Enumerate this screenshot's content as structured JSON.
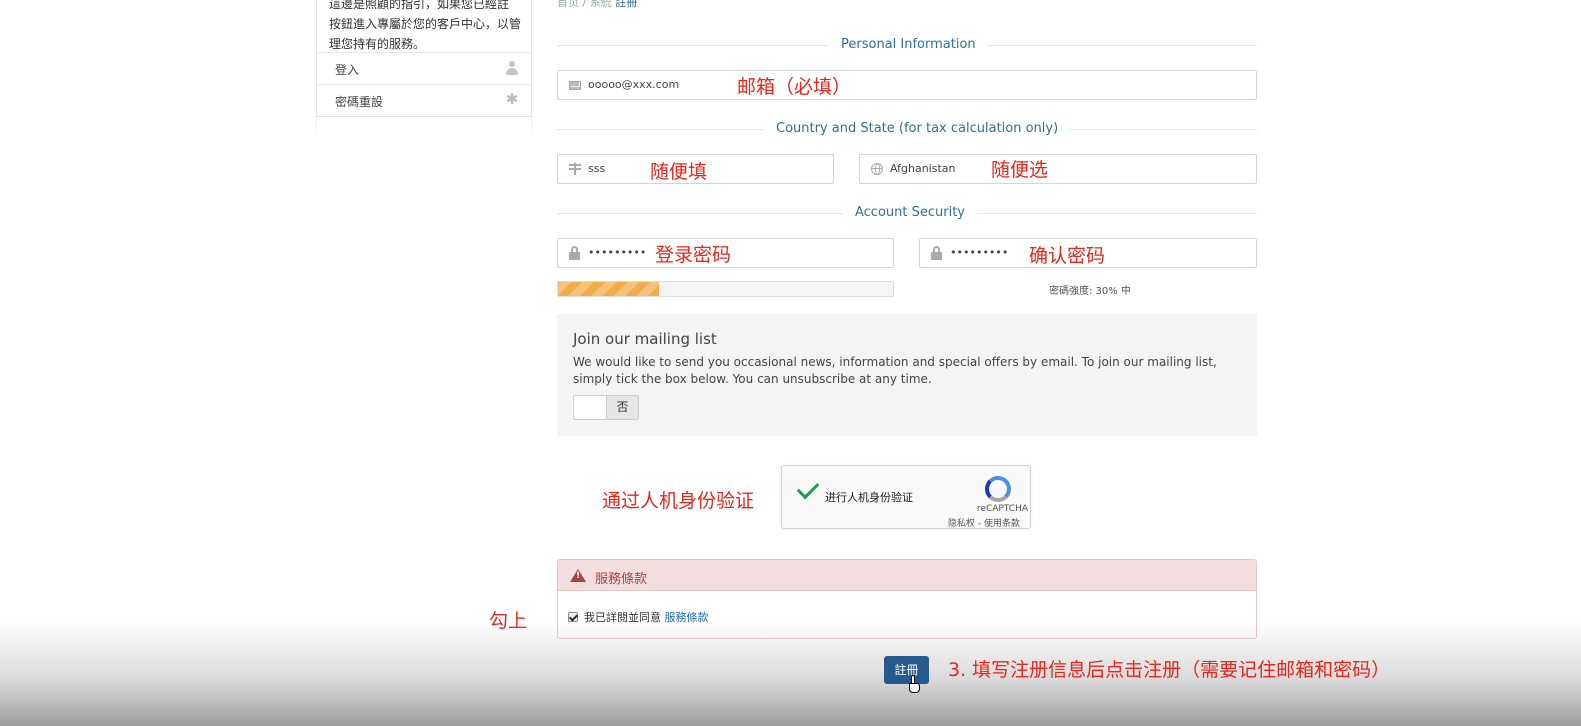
{
  "breadcrumb": {
    "item1": "首页 / 系統",
    "current": "註冊"
  },
  "sidebar": {
    "text_line1": "這邊是照顧的指引，如果您已經註冊，這邊",
    "text_line2": "按鈕進入專屬於您的客戶中心，以管",
    "text_line3": "理您持有的服務。",
    "items": [
      {
        "label": "登入",
        "icon": "user-icon"
      },
      {
        "label": "密碼重設",
        "icon": "asterisk-icon"
      }
    ]
  },
  "sections": {
    "personal": "Personal Information",
    "country": "Country and State (for tax calculation only)",
    "security": "Account Security"
  },
  "fields": {
    "email": "ooooo@xxx.com",
    "state": "sss",
    "country": "Afghanistan",
    "password": "•••••••••",
    "confirm_password": "•••••••••"
  },
  "annotations": {
    "email": "邮箱（必填）",
    "state": "随便填",
    "country": "随便选",
    "password": "登录密码",
    "confirm": "确认密码",
    "captcha": "通过人机身份验证",
    "terms": "勾上",
    "register": "3. 填写注册信息后点击注册（需要记住邮箱和密码）"
  },
  "strength": {
    "label": "密碼強度: 30% 中",
    "value": 0.3
  },
  "mailing": {
    "title": "Join our mailing list",
    "desc": "We would like to send you occasional news, information and special offers by email. To join our mailing list, simply tick the box below. You can unsubscribe at any time.",
    "toggle_label": "否"
  },
  "recaptcha": {
    "label": "进行人机身份验证",
    "brand": "reCAPTCHA",
    "links": "隐私权 - 使用条款"
  },
  "terms": {
    "title": "服務條款",
    "agree_text": "我已詳閱並同意",
    "link": "服務條款"
  },
  "register": {
    "label": "註冊"
  },
  "colors": {
    "accent": "#2f6f9f",
    "annotation": "#e8261c",
    "button": "#245a8d",
    "strength": "#f0ad4e"
  }
}
